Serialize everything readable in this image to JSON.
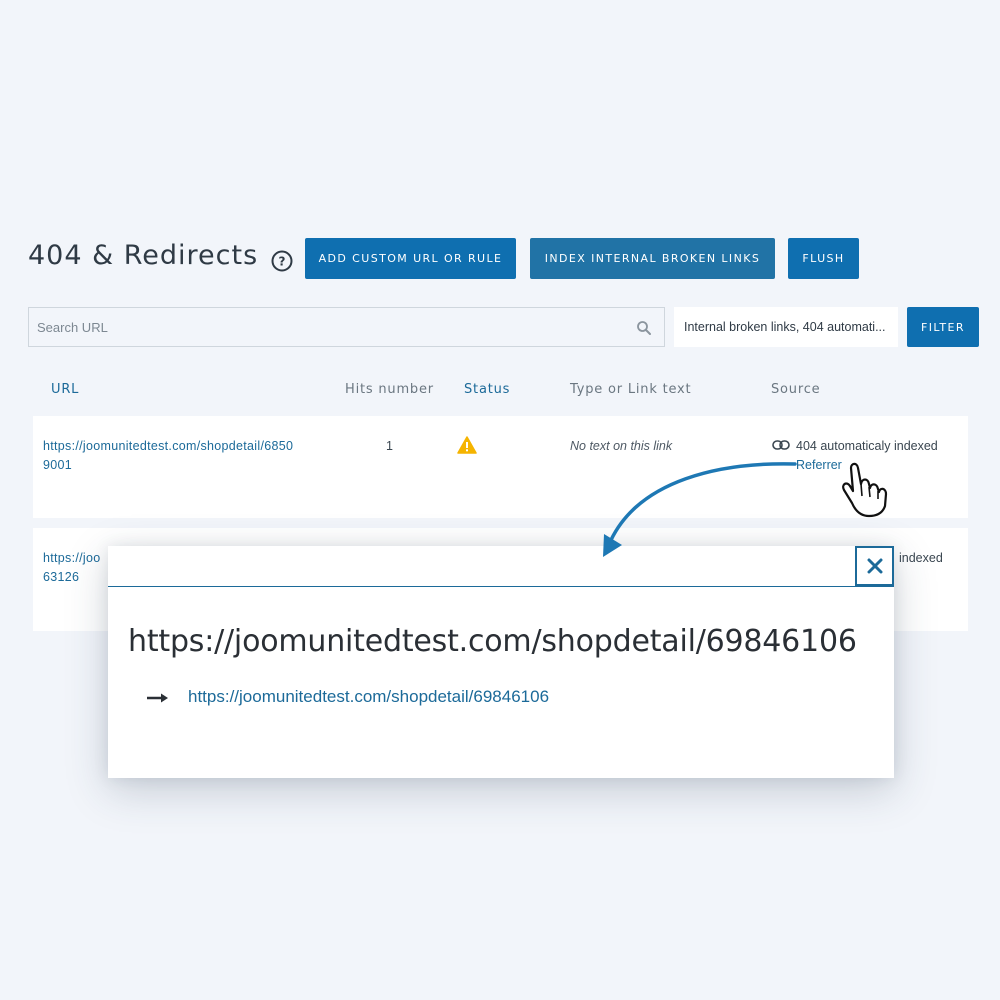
{
  "page": {
    "title": "404 & Redirects",
    "buttons": {
      "add": "ADD CUSTOM URL OR RULE",
      "index": "INDEX INTERNAL BROKEN LINKS",
      "flush": "FLUSH",
      "filter": "FILTER"
    }
  },
  "search": {
    "placeholder": "Search URL",
    "value": ""
  },
  "filter_select": {
    "selected": "Internal broken links, 404 automati..."
  },
  "table": {
    "headers": [
      "URL",
      "Hits number",
      "Status",
      "Type or Link text",
      "Source"
    ],
    "rows": [
      {
        "url_line1": "https://joomunitedtest.com/shopdetail/6850",
        "url_line2": "9001",
        "hits": "1",
        "status_icon": "warning-icon",
        "link_text": "No text on this link",
        "source": "404 automaticaly indexed",
        "referrer": "Referrer"
      },
      {
        "url_line1": "https://joo",
        "url_line2": "63126",
        "source": "indexed"
      }
    ]
  },
  "modal": {
    "title": "https://joomunitedtest.com/shopdetail/69846106",
    "link": "https://joomunitedtest.com/shopdetail/69846106"
  },
  "colors": {
    "background": "#f2f5fa",
    "primary_button": "#0f6fb0",
    "link": "#1c6a99",
    "warning": "#f5b400"
  }
}
